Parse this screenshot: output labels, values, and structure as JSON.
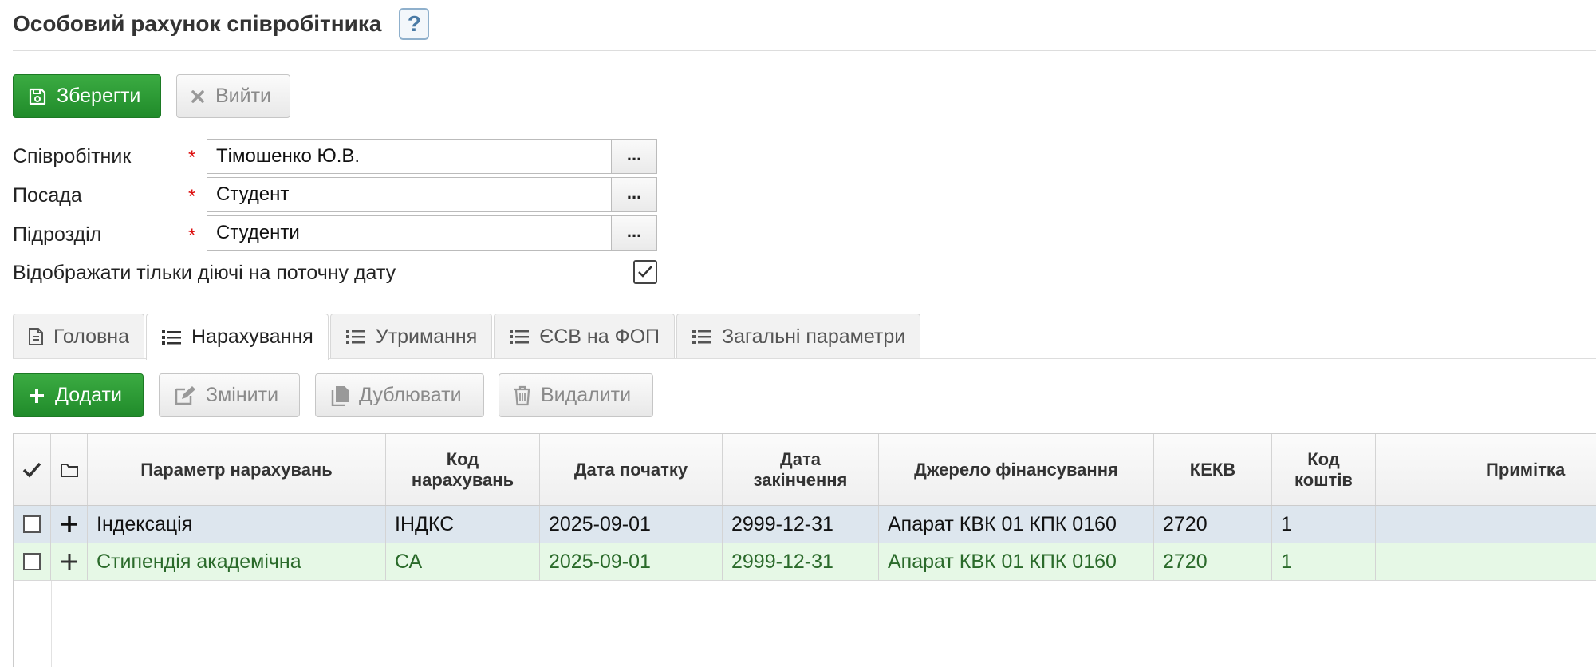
{
  "header": {
    "title": "Особовий рахунок співробітника",
    "help_label": "?"
  },
  "toolbar": {
    "save_label": "Зберегти",
    "exit_label": "Вийти"
  },
  "form": {
    "employee_label": "Співробітник",
    "employee_value": "Тімошенко Ю.В.",
    "position_label": "Посада",
    "position_value": "Студент",
    "department_label": "Підрозділ",
    "department_value": "Студенти",
    "required_mark": "*",
    "browse_label": "...",
    "active_only_label": "Відображати тільки діючі на поточну дату",
    "active_only_checked": true
  },
  "tabs": [
    {
      "label": "Головна",
      "icon": "document-icon"
    },
    {
      "label": "Нарахування",
      "icon": "list-icon",
      "active": true
    },
    {
      "label": "Утримання",
      "icon": "list-icon"
    },
    {
      "label": "ЄСВ на ФОП",
      "icon": "list-icon"
    },
    {
      "label": "Загальні параметри",
      "icon": "list-icon"
    }
  ],
  "actions": {
    "add_label": "Додати",
    "edit_label": "Змінити",
    "duplicate_label": "Дублювати",
    "delete_label": "Видалити"
  },
  "table": {
    "columns": [
      "Параметр нарахувань",
      "Код нарахувань",
      "Дата початку",
      "Дата закінчення",
      "Джерело фінансування",
      "КЕКВ",
      "Код коштів",
      "Примітка"
    ],
    "rows": [
      {
        "param": "Індексація",
        "code": "ІНДКС",
        "start": "2025-09-01",
        "end": "2999-12-31",
        "source": "Апарат КВК 01 КПК 0160",
        "kekv": "2720",
        "fund_code": "1",
        "note": ""
      },
      {
        "param": "Стипендія академічна",
        "code": "СА",
        "start": "2025-09-01",
        "end": "2999-12-31",
        "source": "Апарат КВК 01 КПК 0160",
        "kekv": "2720",
        "fund_code": "1",
        "note": ""
      }
    ]
  },
  "colors": {
    "accent_green": "#2a9a33",
    "row_selected": "#dde6ee",
    "row_highlight": "#e6f8e6",
    "required": "#dd1111"
  }
}
